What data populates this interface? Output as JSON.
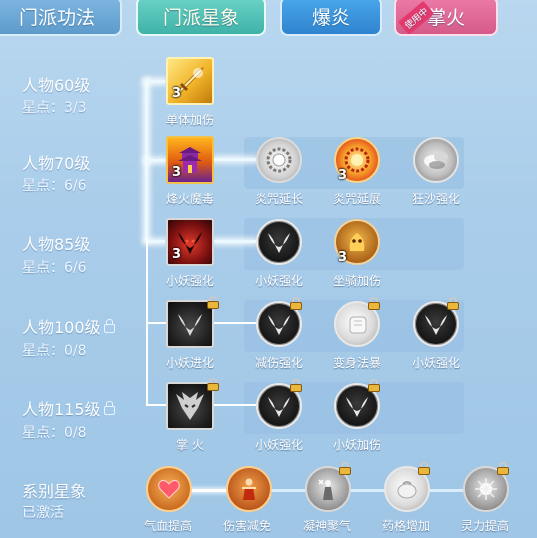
{
  "tabs": [
    {
      "label": "门派功法",
      "state": "inactive"
    },
    {
      "label": "门派星象",
      "state": "active"
    },
    {
      "label": "爆炎",
      "state": "inactive"
    },
    {
      "label": "掌火",
      "state": "inactive",
      "corner_badge": "使用中"
    }
  ],
  "rows": [
    {
      "level": "人物60级",
      "points": "星点：3/3",
      "locked": false
    },
    {
      "level": "人物70级",
      "points": "星点：6/6",
      "locked": false
    },
    {
      "level": "人物85级",
      "points": "星点：6/6",
      "locked": false
    },
    {
      "level": "人物100级",
      "points": "星点：0/8",
      "locked": true
    },
    {
      "level": "人物115级",
      "points": "星点：0/8",
      "locked": true
    }
  ],
  "nodes": {
    "r1": [
      {
        "label": "单体加伤",
        "count": "3",
        "icon": "golden-blade-icon"
      }
    ],
    "r2": [
      {
        "label": "烽火魔毒",
        "count": "3",
        "icon": "fire-pagoda-icon"
      },
      {
        "label": "炎咒延长",
        "count": "",
        "icon": "silver-rune-icon"
      },
      {
        "label": "炎咒延展",
        "count": "3",
        "icon": "fire-rune-icon"
      },
      {
        "label": "狂沙强化",
        "count": "",
        "icon": "sandstorm-icon"
      }
    ],
    "r3": [
      {
        "label": "小妖强化",
        "count": "3",
        "icon": "red-imp-icon"
      },
      {
        "label": "小妖强化",
        "count": "",
        "icon": "dark-imp-icon"
      },
      {
        "label": "坐骑加伤",
        "count": "3",
        "icon": "mount-beast-icon"
      }
    ],
    "r4": [
      {
        "label": "小妖进化",
        "count": "",
        "icon": "dark-imp-icon"
      },
      {
        "label": "减伤强化",
        "count": "",
        "icon": "dark-imp-icon"
      },
      {
        "label": "变身法暴",
        "count": "",
        "icon": "white-fist-icon"
      },
      {
        "label": "小妖强化",
        "count": "",
        "icon": "dark-imp-icon"
      }
    ],
    "r5": [
      {
        "label": "掌 火",
        "count": "",
        "icon": "palm-fire-demon-icon"
      },
      {
        "label": "小妖强化",
        "count": "",
        "icon": "dark-imp-icon"
      },
      {
        "label": "小妖加伤",
        "count": "",
        "icon": "dark-imp-icon"
      }
    ]
  },
  "series": {
    "title": "系别星象",
    "status": "已激活",
    "items": [
      {
        "label": "气血提高",
        "icon": "heart-icon"
      },
      {
        "label": "伤害减免",
        "icon": "fighter-icon"
      },
      {
        "label": "凝神聚气",
        "icon": "snowflake-figure-icon"
      },
      {
        "label": "药格增加",
        "icon": "white-pouch-icon"
      },
      {
        "label": "灵力提高",
        "icon": "spirit-burst-icon"
      }
    ]
  },
  "colors": {
    "background": "#a9cdea",
    "active_tab": "#3fb2a8",
    "tab_blue": "#2f84cf",
    "tab_pink": "#d45a8a",
    "lock_gold": "#e9b73a"
  }
}
